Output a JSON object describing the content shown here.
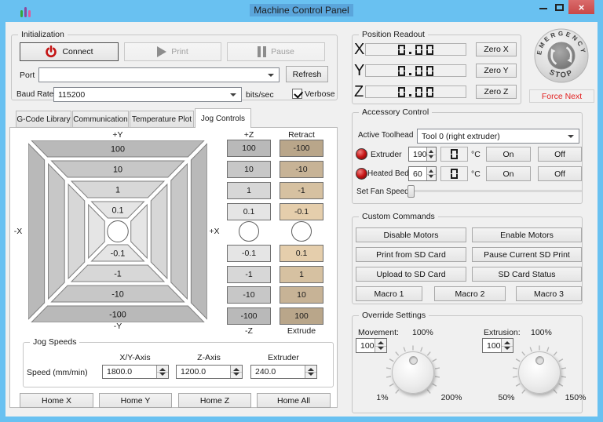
{
  "window": {
    "title": "Machine Control Panel"
  },
  "init": {
    "label": "Initialization",
    "connect": "Connect",
    "print": "Print",
    "pause": "Pause",
    "port_label": "Port",
    "port_value": "",
    "refresh": "Refresh",
    "baud_label": "Baud Rate",
    "baud_value": "115200",
    "bits": "bits/sec",
    "verbose": "Verbose"
  },
  "tabs": {
    "t0": "G-Code Library",
    "t1": "Communication",
    "t2": "Temperature Plot",
    "t3": "Jog Controls"
  },
  "jog": {
    "plus_y": "+Y",
    "minus_y": "-Y",
    "minus_x": "-X",
    "plus_x": "+X",
    "xy_top": [
      "100",
      "10",
      "1",
      "0.1"
    ],
    "xy_bottom": [
      "-0.1",
      "-1",
      "-10",
      "-100"
    ],
    "plus_z": "+Z",
    "minus_z": "-Z",
    "z_top": [
      "100",
      "10",
      "1",
      "0.1"
    ],
    "z_bottom": [
      "-0.1",
      "-1",
      "-10",
      "-100"
    ],
    "retract": "Retract",
    "extrude": "Extrude",
    "e_top": [
      "-100",
      "-10",
      "-1",
      "-0.1"
    ],
    "e_bottom": [
      "0.1",
      "1",
      "10",
      "100"
    ]
  },
  "speeds": {
    "label": "Jog Speeds",
    "col0": "X/Y-Axis",
    "col1": "Z-Axis",
    "col2": "Extruder",
    "row": "Speed (mm/min)",
    "v0": "1800.0",
    "v1": "1200.0",
    "v2": "240.0"
  },
  "home": {
    "x": "Home X",
    "y": "Home Y",
    "z": "Home Z",
    "all": "Home All"
  },
  "position": {
    "label": "Position Readout",
    "x": {
      "axis": "X",
      "value": "0.00",
      "zero": "Zero X"
    },
    "y": {
      "axis": "Y",
      "value": "0.00",
      "zero": "Zero Y"
    },
    "z": {
      "axis": "Z",
      "value": "0.00",
      "zero": "Zero Z"
    }
  },
  "estop": {
    "line1": "EMERGENCY",
    "line2": "STOP",
    "force": "Force Next"
  },
  "accessory": {
    "label": "Accessory Control",
    "toolhead_label": "Active Toolhead",
    "toolhead_value": "Tool 0 (right extruder)",
    "extruder": {
      "name": "Extruder",
      "set": "190",
      "reading": "0",
      "unit": "°C",
      "on": "On",
      "off": "Off"
    },
    "bed": {
      "name": "Heated Bed",
      "set": "60",
      "reading": "0",
      "unit": "°C",
      "on": "On",
      "off": "Off"
    },
    "fan_label": "Set Fan Speed"
  },
  "custom": {
    "label": "Custom Commands",
    "b00": "Disable Motors",
    "b01": "Enable Motors",
    "b10": "Print from SD Card",
    "b11": "Pause Current SD Print",
    "b20": "Upload to SD Card",
    "b21": "SD Card Status",
    "m0": "Macro 1",
    "m1": "Macro 2",
    "m2": "Macro 3"
  },
  "override": {
    "label": "Override Settings",
    "movement": {
      "name": "Movement:",
      "value": "100",
      "current": "100%",
      "min": "1%",
      "max": "200%"
    },
    "extrusion": {
      "name": "Extrusion:",
      "value": "100",
      "current": "100%",
      "min": "50%",
      "max": "150%"
    }
  }
}
